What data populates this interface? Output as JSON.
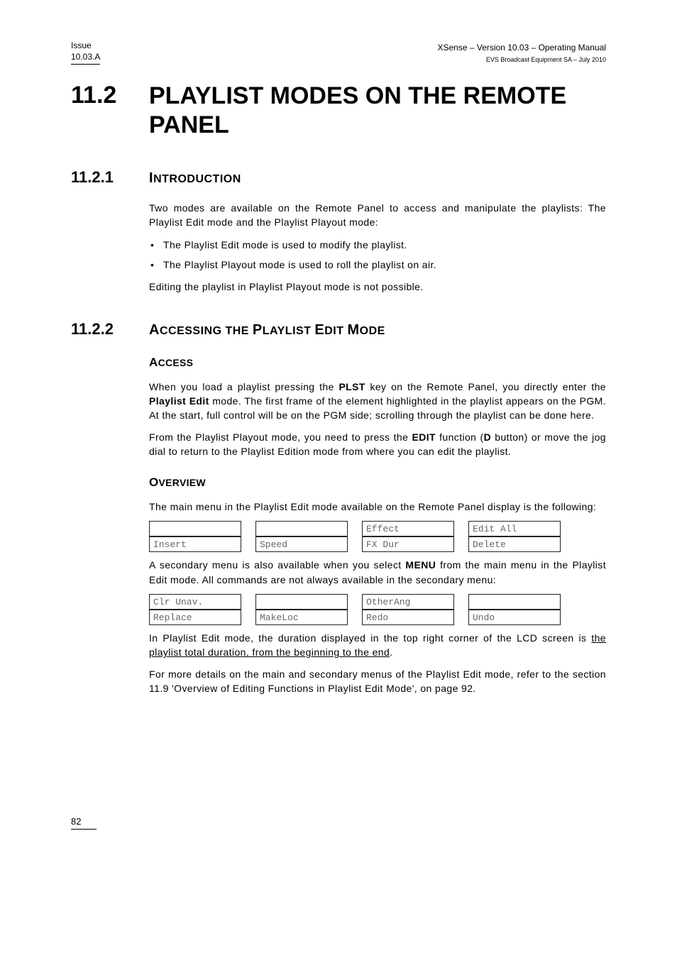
{
  "header": {
    "issue_label": "Issue",
    "issue_value": "10.03.A",
    "right_line1": "XSense – Version 10.03 – Operating Manual",
    "right_line2": "EVS Broadcast Equipment SA – July 2010"
  },
  "h1": {
    "num": "11.2",
    "text": "PLAYLIST MODES ON THE REMOTE PANEL"
  },
  "s1": {
    "num": "11.2.1",
    "title_first": "I",
    "title_rest": "NTRODUCTION",
    "p1": "Two modes are available on the Remote Panel to access and manipulate the playlists: The Playlist Edit mode and the Playlist Playout mode:",
    "bullet1": "The Playlist Edit mode is used to modify the playlist.",
    "bullet2": "The Playlist Playout mode is used to roll the playlist on air.",
    "p2": "Editing the playlist in Playlist Playout mode is not possible."
  },
  "s2": {
    "num": "11.2.2",
    "title_parts": {
      "a1": "A",
      "a2": "CCESSING THE ",
      "p1": "P",
      "p2": "LAYLIST ",
      "e1": "E",
      "e2": "DIT ",
      "m1": "M",
      "m2": "ODE"
    },
    "access": {
      "title_first": "A",
      "title_rest": "CCESS",
      "p1_a": "When you load a playlist pressing the ",
      "p1_b": "PLST",
      "p1_c": " key on the Remote Panel, you directly enter the ",
      "p1_d": "Playlist Edit",
      "p1_e": " mode. The first frame of the element highlighted in the playlist appears on the PGM. At the start, full control will be on the PGM side; scrolling through the playlist can be done here.",
      "p2_a": "From the Playlist Playout mode, you need to press the ",
      "p2_b": "EDIT",
      "p2_c": " function (",
      "p2_d": "D",
      "p2_e": " button) or move the jog dial to return to the Playlist Edition mode from where you can edit the playlist."
    },
    "overview": {
      "title_first": "O",
      "title_rest": "VERVIEW",
      "p1": "The main menu in the Playlist Edit mode available on the Remote Panel display is the following:",
      "menu1": {
        "r1c1": "",
        "r1c2": "",
        "r1c3": "Effect",
        "r1c4": "Edit All",
        "r2c1": "Insert",
        "r2c2": "Speed",
        "r2c3": "FX Dur",
        "r2c4": "Delete"
      },
      "p2_a": "A secondary menu is also available when you select ",
      "p2_b": "MENU",
      "p2_c": " from the main menu in the Playlist Edit mode. All commands are not always available in the secondary menu:",
      "menu2": {
        "r1c1": "Clr Unav.",
        "r1c2": "",
        "r1c3": "OtherAng",
        "r1c4": "",
        "r2c1": "Replace",
        "r2c2": "MakeLoc",
        "r2c3": "Redo",
        "r2c4": "Undo"
      },
      "p3_a": "In Playlist Edit mode, the duration displayed in the top right corner of the LCD screen is ",
      "p3_b": "the playlist total duration, from the beginning to the end",
      "p3_c": ".",
      "p4": "For more details on the main and secondary menus of the Playlist Edit mode, refer to the section 11.9 'Overview of Editing Functions in Playlist Edit Mode', on page 92."
    }
  },
  "footer": {
    "page": "82"
  }
}
